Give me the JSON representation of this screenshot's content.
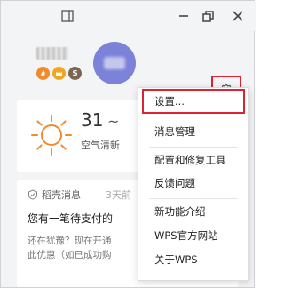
{
  "profile": {
    "badge_coin": "$"
  },
  "weather": {
    "temperature": "31",
    "separator": "~",
    "description": "空气清新"
  },
  "news": {
    "source": "稻壳消息",
    "time": "3天前",
    "title": "您有一笔待支付的",
    "body_line1": "还在犹豫？现在开通",
    "body_line2": "此优惠（如已成功购"
  },
  "menu": {
    "items": [
      {
        "label": "设置..."
      },
      {
        "label": "消息管理"
      },
      {
        "label": "配置和修复工具"
      },
      {
        "label": "反馈问题"
      },
      {
        "label": "新功能介绍"
      },
      {
        "label": "WPS官方网站"
      },
      {
        "label": "关于WPS"
      }
    ]
  },
  "colors": {
    "highlight": "#dd2233",
    "avatar": "#7b82d8",
    "sun": "#f08a2b"
  },
  "icons": [
    "sidebar-icon",
    "minimize-icon",
    "restore-icon",
    "close-icon",
    "gear-icon",
    "sun-icon",
    "fire-icon",
    "crown-icon",
    "coin-icon",
    "shell-icon"
  ]
}
